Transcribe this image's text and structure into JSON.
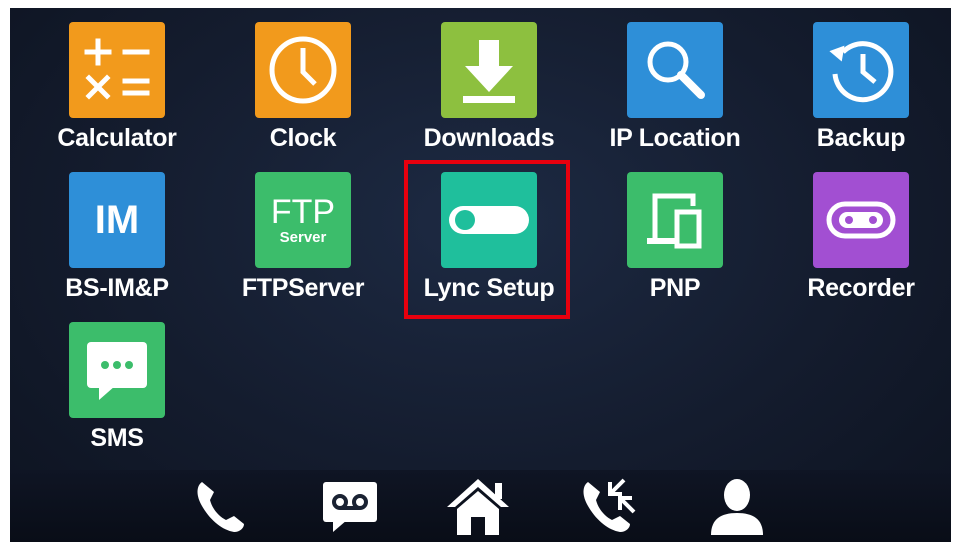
{
  "apps": [
    {
      "label": "Calculator",
      "icon": "calculator-icon",
      "color": "#f29a1c"
    },
    {
      "label": "Clock",
      "icon": "clock-icon",
      "color": "#f29a1c"
    },
    {
      "label": "Downloads",
      "icon": "download-icon",
      "color": "#8dc03f"
    },
    {
      "label": "IP Location",
      "icon": "ip-location-icon",
      "color": "#2e8fd8"
    },
    {
      "label": "Backup",
      "icon": "backup-icon",
      "color": "#2e8fd8"
    },
    {
      "label": "BS-IM&P",
      "icon": "im-icon",
      "color": "#2e8fd8",
      "icon_text": "IM"
    },
    {
      "label": "FTPServer",
      "icon": "ftp-server-icon",
      "color": "#3cbd6b",
      "icon_text": "FTP",
      "icon_subtext": "Server"
    },
    {
      "label": "Lync Setup",
      "icon": "toggle-icon",
      "color": "#1fbf9c"
    },
    {
      "label": "PNP",
      "icon": "devices-icon",
      "color": "#3cbd6b"
    },
    {
      "label": "Recorder",
      "icon": "recorder-icon",
      "color": "#a24fd2"
    },
    {
      "label": "SMS",
      "icon": "sms-icon",
      "color": "#3cbd6b"
    }
  ],
  "highlighted_app": "Lync Setup",
  "highlight_color": "#e8000e",
  "dock": [
    {
      "name": "phone-icon"
    },
    {
      "name": "voicemail-icon"
    },
    {
      "name": "home-icon"
    },
    {
      "name": "call-history-icon"
    },
    {
      "name": "contacts-icon"
    }
  ]
}
